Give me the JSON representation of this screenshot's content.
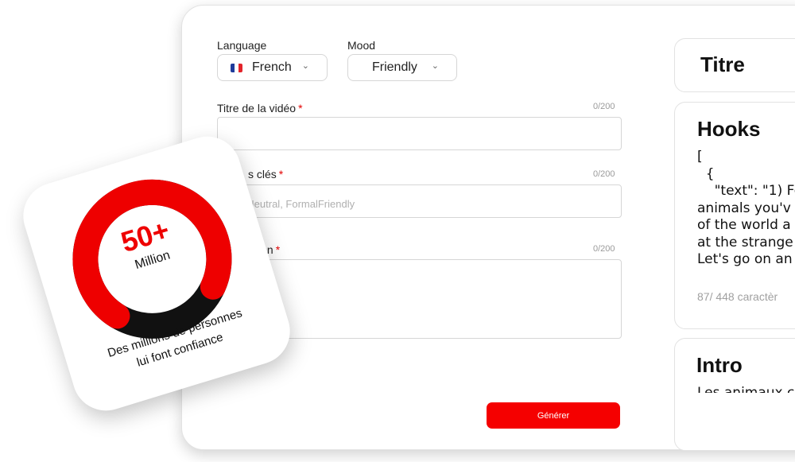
{
  "form": {
    "language_label": "Language",
    "language_value": "French",
    "mood_label": "Mood",
    "mood_value": "Friendly",
    "title_label": "Titre de la vidéo",
    "title_count": "0/200",
    "keywords_label": "s clés",
    "keywords_count": "0/200",
    "keywords_placeholder": "X Neutral, FormalFriendly",
    "description_label": "ion",
    "description_count": "0/200",
    "required_mark": "*",
    "generate_label": "Générer"
  },
  "panels": {
    "titre": "Titre",
    "hooks_title": "Hooks",
    "hooks_text": "[\n  {\n    \"text\": \"1) Fo\nanimals you'v\nof the world a\nat the strange\nLet's go on an",
    "hooks_count": "87/ 448 caractèr",
    "intro_title": "Intro",
    "intro_text": "Les animaux c"
  },
  "stat": {
    "value": "50+",
    "unit": "Million",
    "description_line1": "Des millions de personnes",
    "description_line2": "lui font confiance",
    "ring_fraction": 0.73,
    "ring_color": "#ee0000",
    "ring_track_color": "#111111"
  },
  "colors": {
    "accent": "#f50000"
  }
}
